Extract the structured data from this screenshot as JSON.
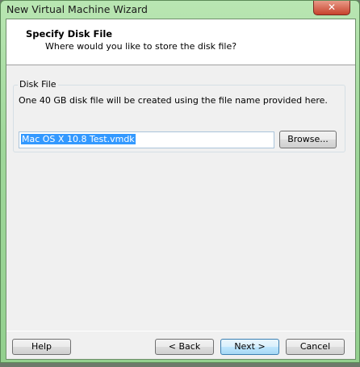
{
  "window": {
    "title": "New Virtual Machine Wizard",
    "close_icon": "close-icon"
  },
  "header": {
    "title": "Specify Disk File",
    "subtitle": "Where would you like to store the disk file?"
  },
  "disk_file": {
    "group_label": "Disk File",
    "description": "One 40 GB disk file will be created using the file name provided here.",
    "file_name": "Mac OS X 10.8 Test.vmdk",
    "browse_label": "Browse..."
  },
  "footer": {
    "help": "Help",
    "back": "< Back",
    "next": "Next >",
    "cancel": "Cancel"
  }
}
